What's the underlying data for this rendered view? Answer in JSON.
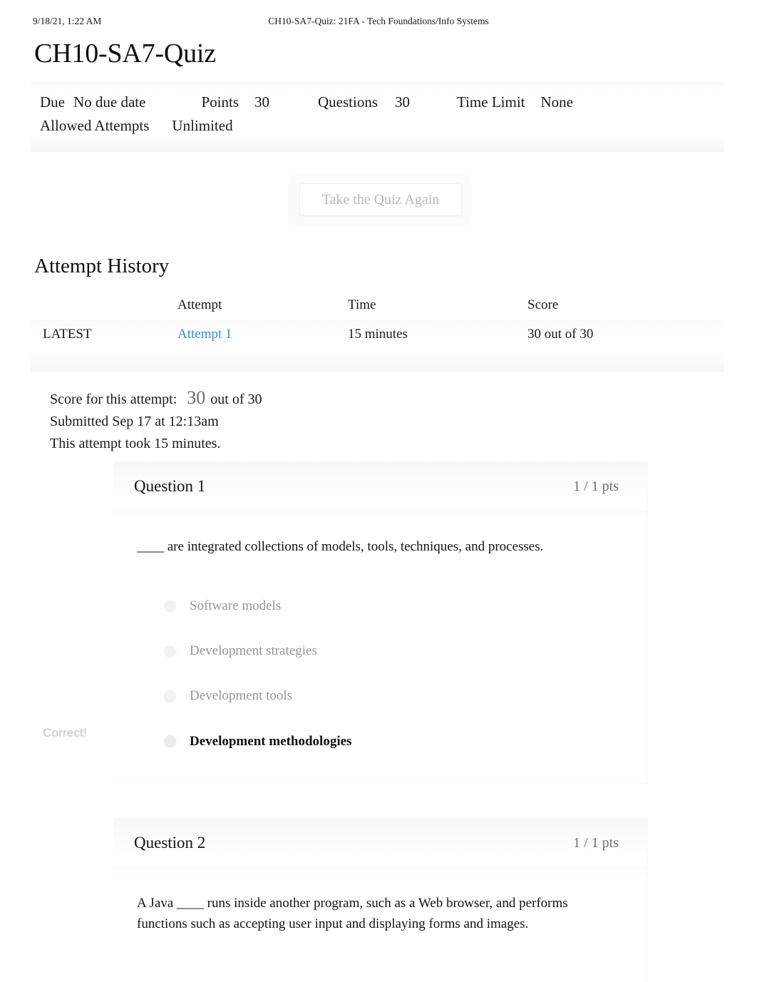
{
  "print_header": {
    "date": "9/18/21, 1:22 AM",
    "doc_title": "CH10-SA7-Quiz: 21FA - Tech Foundations/Info Systems"
  },
  "page": {
    "title": "CH10-SA7-Quiz"
  },
  "quiz_info": {
    "due_label": "Due",
    "due_value": "No due date",
    "points_label": "Points",
    "points_value": "30",
    "questions_label": "Questions",
    "questions_value": "30",
    "time_limit_label": "Time Limit",
    "time_limit_value": "None",
    "allowed_attempts_label": "Allowed Attempts",
    "allowed_attempts_value": "Unlimited"
  },
  "actions": {
    "retake_label": "Take the Quiz Again"
  },
  "attempt_history": {
    "heading": "Attempt History",
    "columns": {
      "flag": "",
      "attempt": "Attempt",
      "time": "Time",
      "score": "Score"
    },
    "rows": [
      {
        "flag": "LATEST",
        "attempt": "Attempt 1",
        "time": "15 minutes",
        "score": "30 out of 30"
      }
    ]
  },
  "score_summary": {
    "score_label": "Score for this attempt:",
    "score_value": "30",
    "score_suffix": "out of 30",
    "submitted": "Submitted Sep 17 at 12:13am",
    "duration": "This attempt took 15 minutes."
  },
  "questions": [
    {
      "title": "Question 1",
      "points": "1 / 1 pts",
      "text": "____ are integrated collections of models, tools, techniques, and processes.",
      "correct_flag": "Correct!",
      "answers": [
        {
          "label": "Software models",
          "selected": false
        },
        {
          "label": "Development strategies",
          "selected": false
        },
        {
          "label": "Development tools",
          "selected": false
        },
        {
          "label": "Development methodologies",
          "selected": true
        }
      ]
    },
    {
      "title": "Question 2",
      "points": "1 / 1 pts",
      "text": "A Java ____ runs inside another program, such as a Web browser, and performs functions such as accepting user input and displaying forms and images.",
      "correct_flag": "",
      "answers": []
    }
  ],
  "colors": {
    "link": "#2d8cf0",
    "text": "#1a1a1a",
    "muted": "#94969a"
  }
}
